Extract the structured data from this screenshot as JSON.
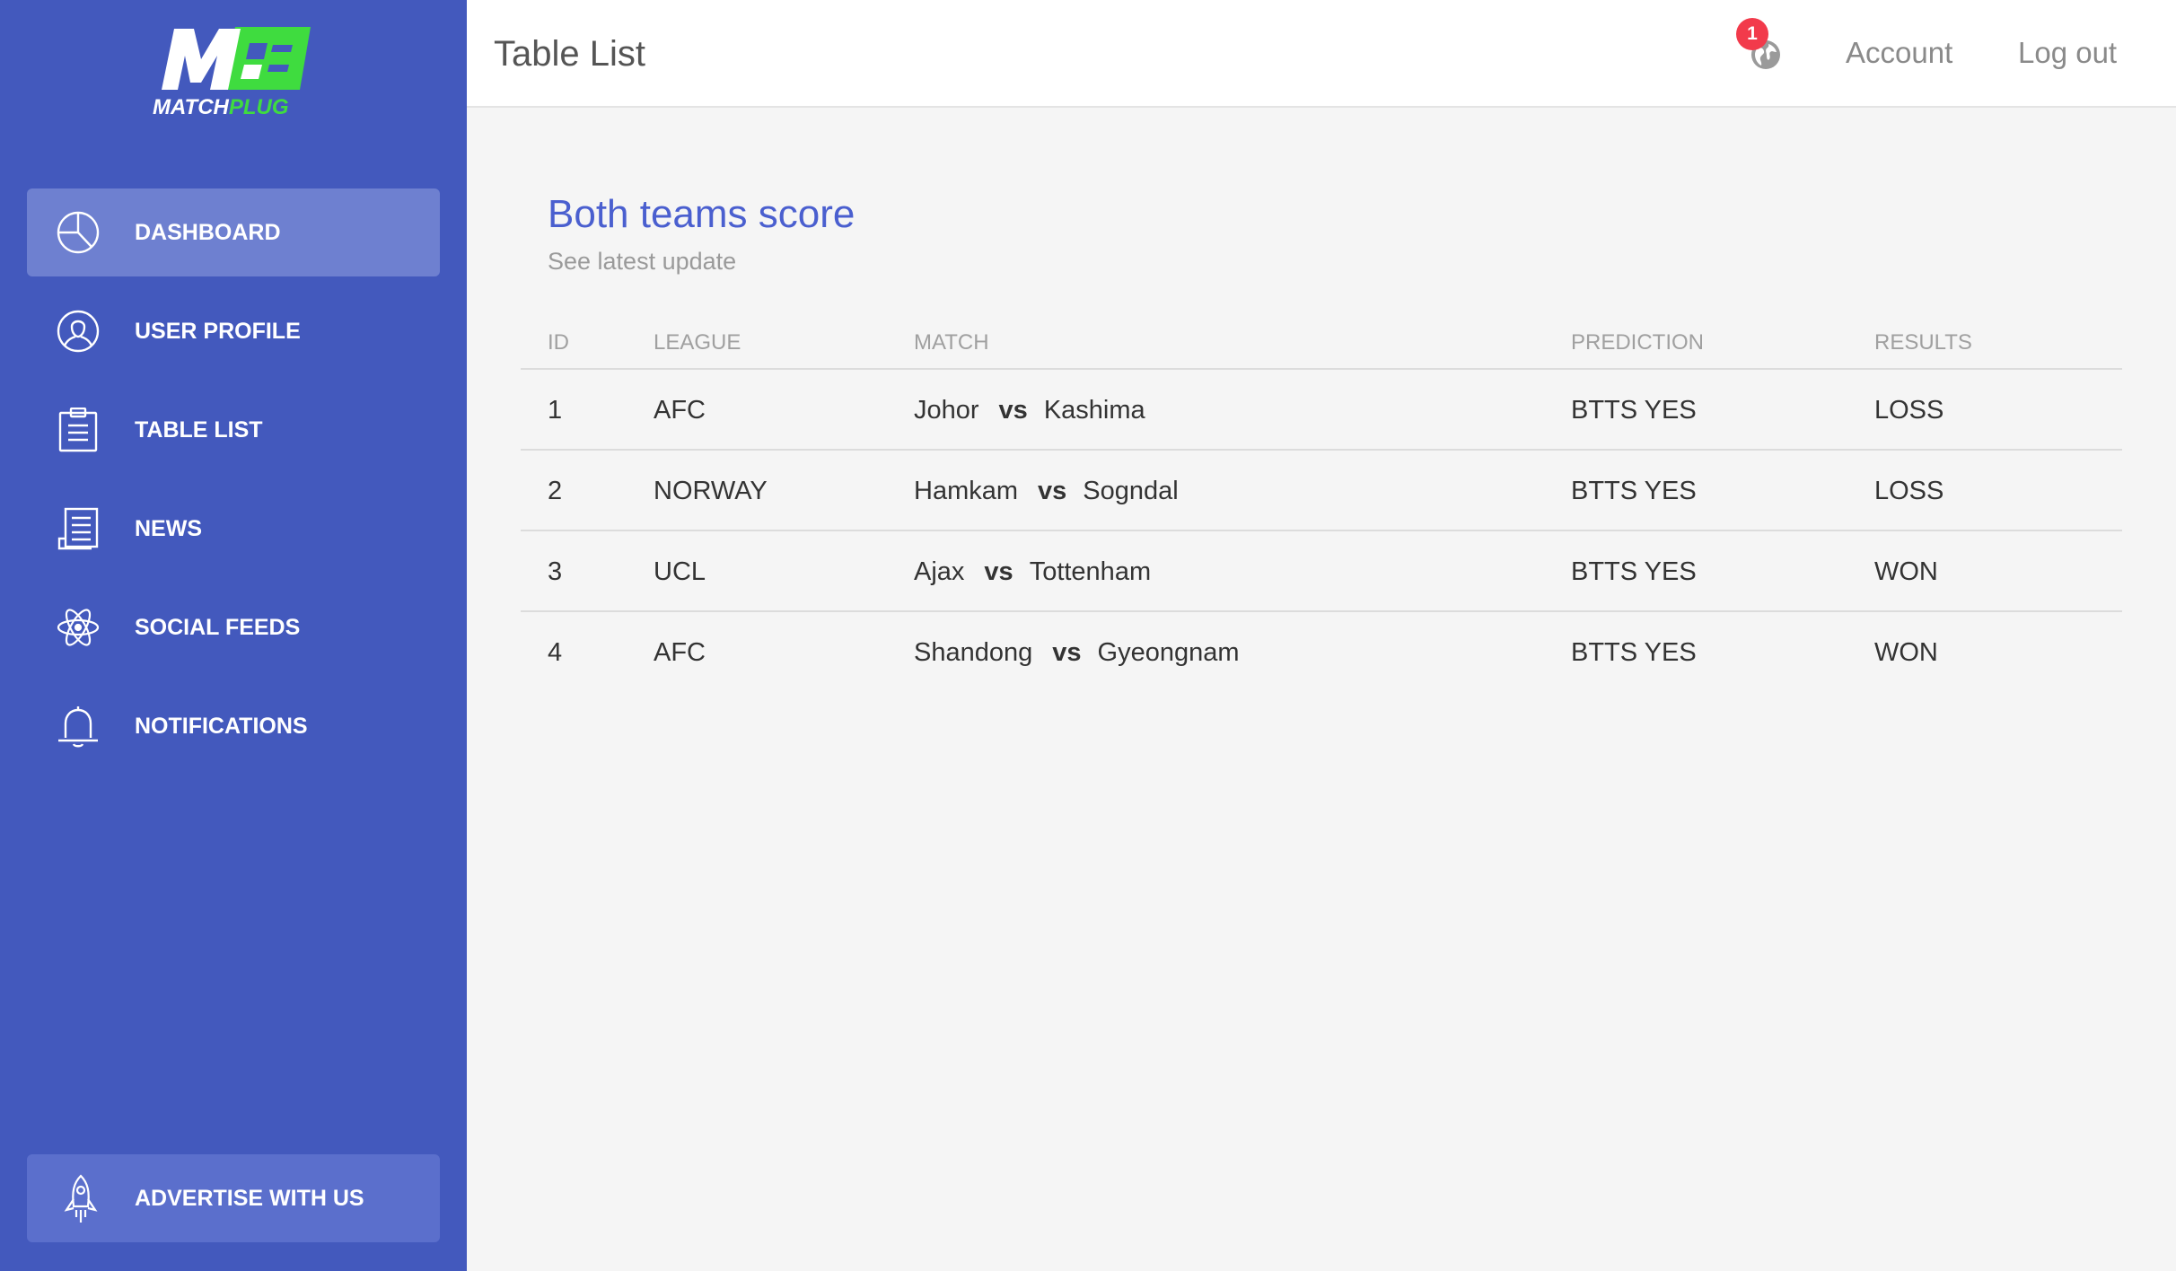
{
  "brand": {
    "logo_letters": "MP",
    "name_part1": "MATCH",
    "name_part2": "PLUG",
    "accent_green": "#3fdc3f"
  },
  "sidebar": {
    "background": "#4359bd",
    "items": [
      {
        "label": "DASHBOARD",
        "icon": "pie-chart-icon",
        "active": true
      },
      {
        "label": "USER PROFILE",
        "icon": "user-icon",
        "active": false
      },
      {
        "label": "TABLE LIST",
        "icon": "clipboard-icon",
        "active": false
      },
      {
        "label": "NEWS",
        "icon": "newspaper-icon",
        "active": false
      },
      {
        "label": "SOCIAL FEEDS",
        "icon": "atom-icon",
        "active": false
      },
      {
        "label": "NOTIFICATIONS",
        "icon": "bell-icon",
        "active": false
      }
    ],
    "advertise": {
      "label": "ADVERTISE WITH US",
      "icon": "rocket-icon"
    }
  },
  "topbar": {
    "title": "Table List",
    "notification_count": "1",
    "account_label": "Account",
    "logout_label": "Log out"
  },
  "card": {
    "title": "Both teams score",
    "subtitle": "See latest update",
    "columns": [
      "ID",
      "LEAGUE",
      "MATCH",
      "PREDICTION",
      "RESULTS"
    ],
    "rows": [
      {
        "id": "1",
        "league": "AFC",
        "home": "Johor",
        "vs": "vs",
        "away": "Kashima",
        "prediction": "BTTS YES",
        "result": "LOSS"
      },
      {
        "id": "2",
        "league": "NORWAY",
        "home": "Hamkam",
        "vs": "vs",
        "away": "Sogndal",
        "prediction": "BTTS YES",
        "result": "LOSS"
      },
      {
        "id": "3",
        "league": "UCL",
        "home": "Ajax",
        "vs": "vs",
        "away": "Tottenham",
        "prediction": "BTTS YES",
        "result": "WON"
      },
      {
        "id": "4",
        "league": "AFC",
        "home": "Shandong",
        "vs": "vs",
        "away": "Gyeongnam",
        "prediction": "BTTS YES",
        "result": "WON"
      }
    ]
  }
}
